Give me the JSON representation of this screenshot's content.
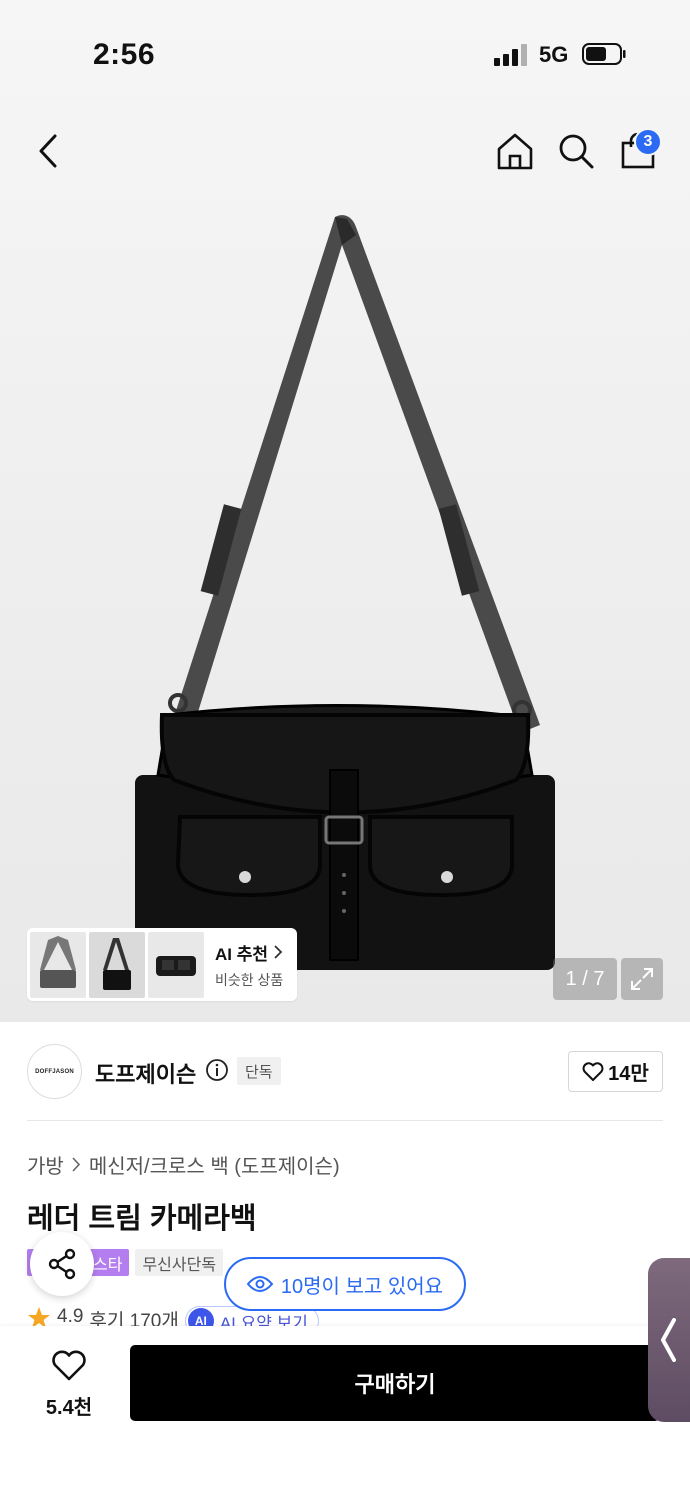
{
  "status_bar": {
    "time": "2:56",
    "network": "5G"
  },
  "nav": {
    "cart_count": "3"
  },
  "gallery": {
    "ai_recommend_title": "AI 추천",
    "ai_recommend_sub": "비슷한 상품",
    "counter": "1 / 7"
  },
  "brand": {
    "logo_text": "DOFFJASON",
    "name": "도프제이슨",
    "exclusive_tag": "단독",
    "like_count": "14만"
  },
  "breadcrumb": {
    "category": "가방",
    "subcategory": "메신저/크로스 백 (도프제이슨)"
  },
  "product": {
    "title": "레더 트림 카메라백"
  },
  "tags": {
    "purple": "스타",
    "gray": "무신사단독"
  },
  "viewers_text": "10명이 보고 있어요",
  "rating": {
    "score": "4.9",
    "reviews": "후기 170개",
    "ai_summary": "AI 요약 보기",
    "ai_badge": "AI"
  },
  "bottom": {
    "wish_count": "5.4천",
    "buy_label": "구매하기"
  },
  "colors": {
    "accent_blue": "#2b6bf3",
    "tag_purple": "#b57ef0",
    "buy_black": "#000000"
  }
}
